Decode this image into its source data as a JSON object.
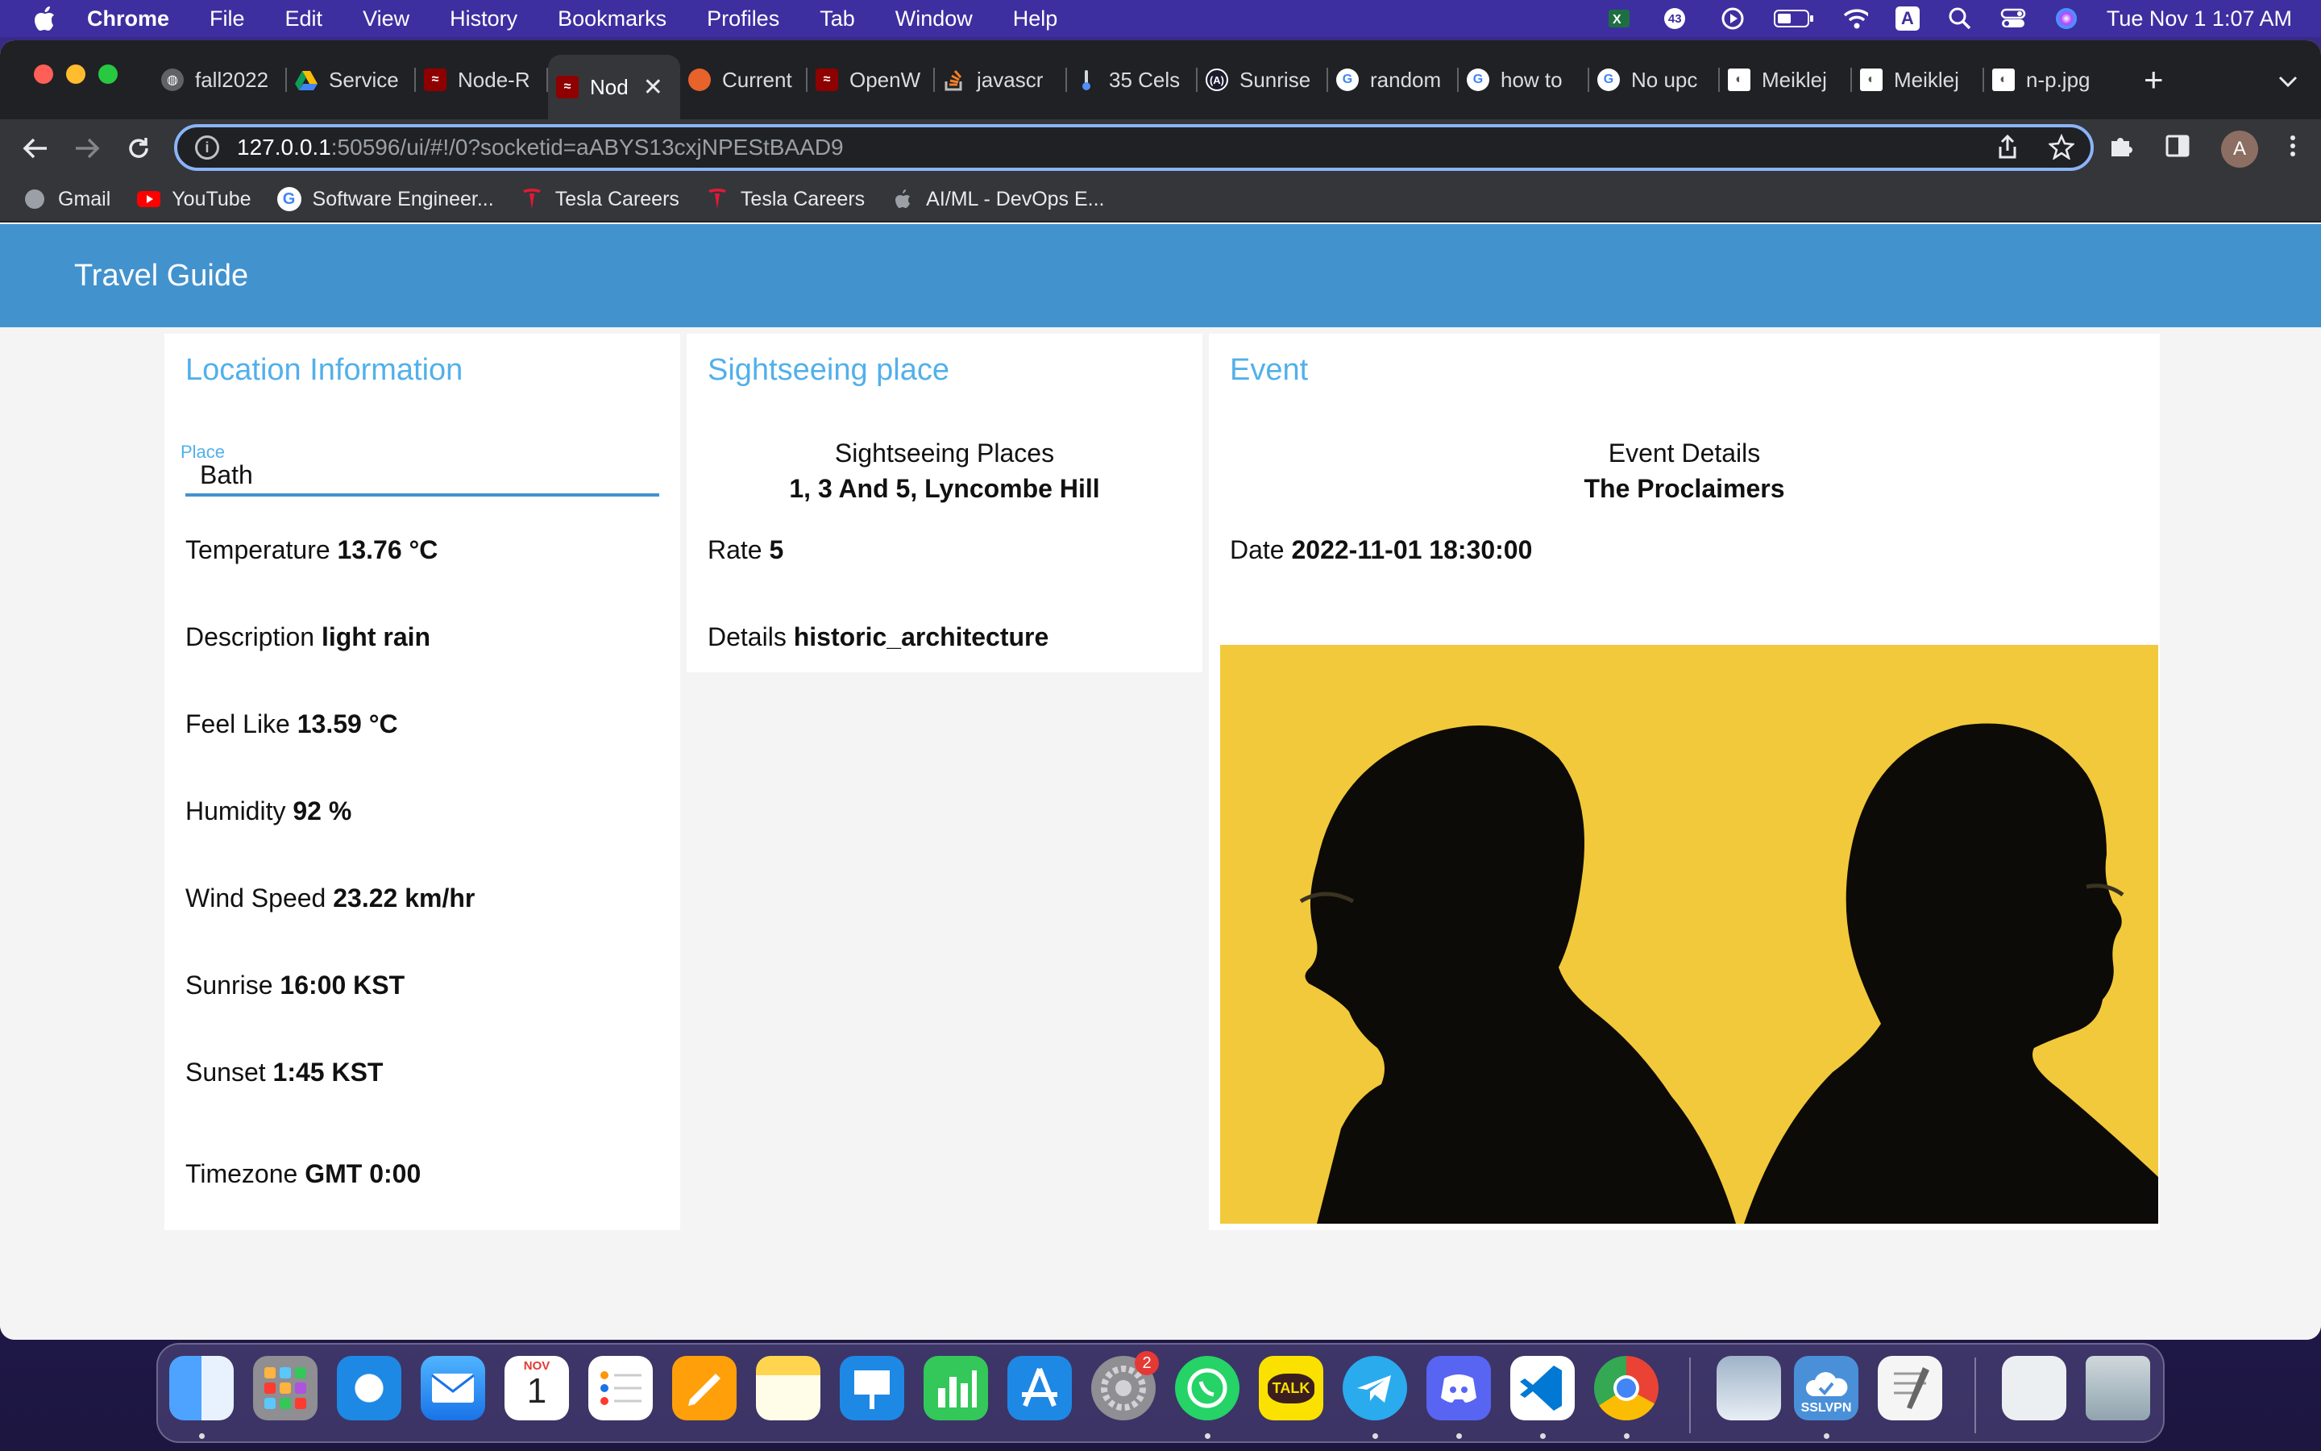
{
  "menubar": {
    "app": "Chrome",
    "items": [
      "File",
      "Edit",
      "View",
      "History",
      "Bookmarks",
      "Profiles",
      "Tab",
      "Window",
      "Help"
    ],
    "badge_count": "43",
    "clock": "Tue Nov 1  1:07 AM",
    "input_indicator": "A"
  },
  "browser": {
    "tabs": [
      {
        "title": "fall2022",
        "color": "#9aa0a6"
      },
      {
        "title": "Service",
        "color": "#fbbc04"
      },
      {
        "title": "Node-R",
        "color": "#8f0000"
      },
      {
        "title": "Nod",
        "color": "#8f0000",
        "active": true
      },
      {
        "title": "Current",
        "color": "#e8622c"
      },
      {
        "title": "OpenW",
        "color": "#8f0000"
      },
      {
        "title": "javascr",
        "color": "#f48024"
      },
      {
        "title": "35 Cels",
        "color": "#4f8ff7"
      },
      {
        "title": "Sunrise",
        "color": "#1a1a2e"
      },
      {
        "title": "random",
        "color": "#ffffff"
      },
      {
        "title": "how to",
        "color": "#ffffff"
      },
      {
        "title": "No upc",
        "color": "#ffffff"
      },
      {
        "title": "Meiklej",
        "color": "#ffffff"
      },
      {
        "title": "Meiklej",
        "color": "#ffffff"
      },
      {
        "title": "n-p.jpg",
        "color": "#ffffff"
      }
    ],
    "url_host": "127.0.0.1",
    "url_rest": ":50596/ui/#!/0?socketid=aABYS13cxjNPEStBAAD9",
    "profile_initial": "A",
    "bookmarks": [
      {
        "label": "Gmail",
        "color": "#9aa0a6"
      },
      {
        "label": "YouTube",
        "color": "#ff0000"
      },
      {
        "label": "Software Engineer...",
        "color": "#ffffff"
      },
      {
        "label": "Tesla Careers",
        "color": "#e31937"
      },
      {
        "label": "Tesla Careers",
        "color": "#e31937"
      },
      {
        "label": "AI/ML - DevOps E...",
        "color": "#9aa0a6"
      }
    ]
  },
  "app": {
    "title": "Travel Guide",
    "location": {
      "heading": "Location Information",
      "place_label": "Place",
      "place_value": "Bath",
      "rows": [
        {
          "label": "Temperature",
          "value": "13.76 °C"
        },
        {
          "label": "Description",
          "value": "light rain"
        },
        {
          "label": "Feel Like",
          "value": "13.59 °C"
        },
        {
          "label": "Humidity",
          "value": "92 %"
        },
        {
          "label": "Wind Speed",
          "value": "23.22 km/hr"
        },
        {
          "label": "Sunrise",
          "value": "16:00 KST"
        },
        {
          "label": "Sunset",
          "value": "1:45 KST"
        },
        {
          "label": "Timezone",
          "value": "GMT 0:00"
        }
      ]
    },
    "sightseeing": {
      "heading": "Sightseeing place",
      "subheading": "Sightseeing Places",
      "name": "1, 3 And 5, Lyncombe Hill",
      "rate_label": "Rate",
      "rate_value": "5",
      "details_label": "Details",
      "details_value": "historic_architecture"
    },
    "event": {
      "heading": "Event",
      "subheading": "Event Details",
      "name": "The Proclaimers",
      "date_label": "Date",
      "date_value": "2022-11-01 18:30:00"
    }
  },
  "dock": {
    "calendar_month": "NOV",
    "calendar_day": "1",
    "settings_badge": "2",
    "kakao_label": "TALK",
    "vpn_label": "SSLVPN"
  }
}
